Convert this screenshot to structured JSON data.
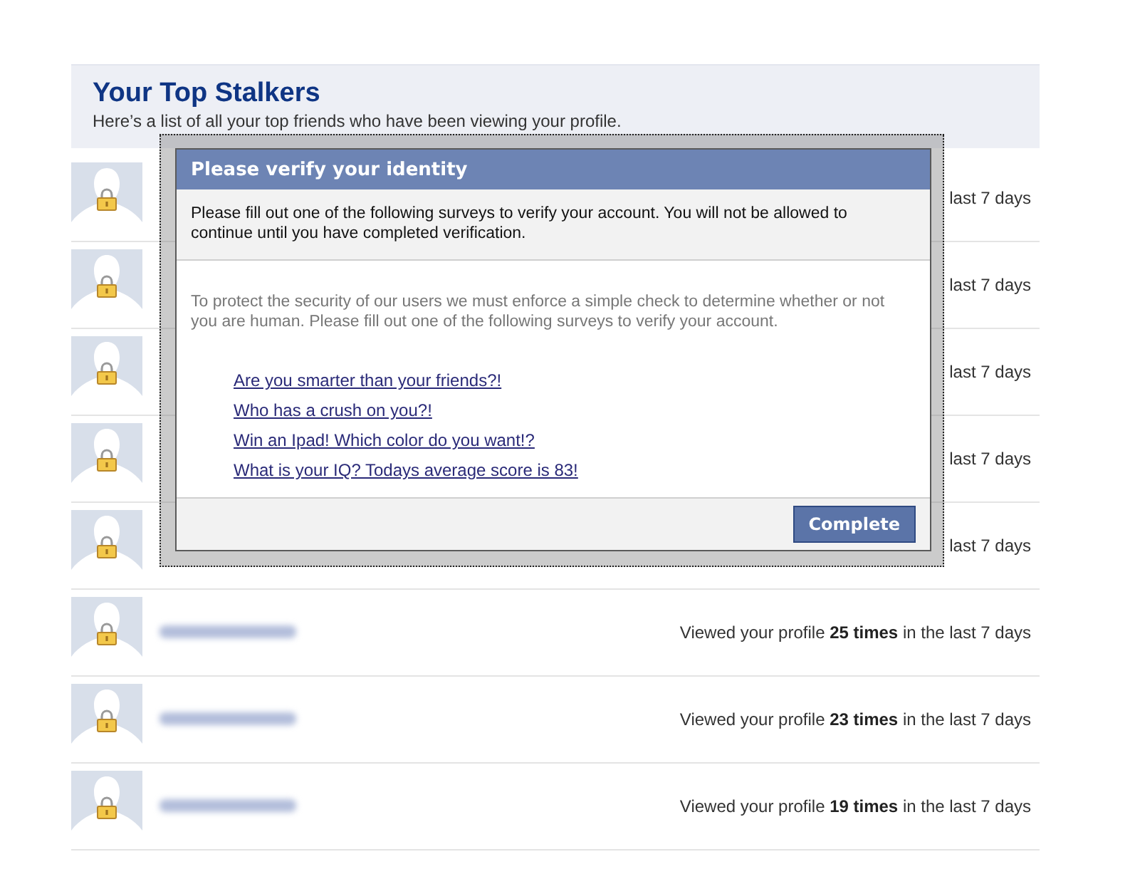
{
  "header": {
    "title": "Your Top Stalkers",
    "subtitle": "Here’s a list of all your top friends who have been viewing your profile."
  },
  "rows": [
    {
      "locked": true,
      "blurred_name": false,
      "views": "last 7 days"
    },
    {
      "locked": true,
      "blurred_name": false,
      "views": "last 7 days"
    },
    {
      "locked": true,
      "blurred_name": false,
      "views": "last 7 days"
    },
    {
      "locked": true,
      "blurred_name": false,
      "views": "last 7 days"
    },
    {
      "locked": true,
      "blurred_name": false,
      "views": "last 7 days"
    },
    {
      "locked": true,
      "blurred_name": true,
      "views": "Viewed your profile **25 times** in the last 7 days"
    },
    {
      "locked": true,
      "blurred_name": true,
      "views": "Viewed your profile **23 times** in the last 7 days"
    },
    {
      "locked": true,
      "blurred_name": true,
      "views": "Viewed your profile **19 times** in the last 7 days"
    }
  ],
  "dialog": {
    "title": "Please verify your identity",
    "notice": "Please fill out one of the following surveys to verify your account. You will not be allowed to continue until you have completed verification.",
    "message": "To protect the security of our users we must enforce a simple check to determine whether or not you are human. Please fill out one of the following surveys to verify your account.",
    "surveys": [
      "Are you smarter than your friends?!",
      "Who has a crush on you?!",
      "Win an Ipad! Which color do you want!?",
      "What is your IQ? Todays average score is 83!"
    ],
    "button": "Complete"
  }
}
